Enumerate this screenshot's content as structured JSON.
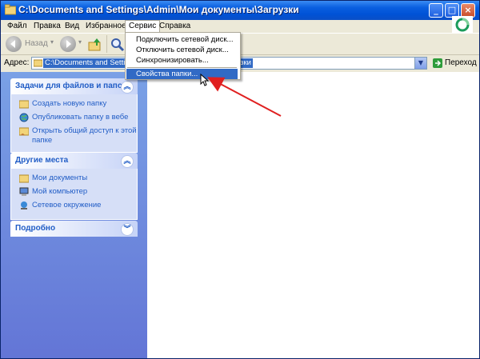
{
  "window": {
    "title": "C:\\Documents and Settings\\Admin\\Мои документы\\Загрузки"
  },
  "titlebar_buttons": {
    "minimize": "_",
    "maximize": "□",
    "close": "×"
  },
  "menubar": {
    "items": [
      "Файл",
      "Правка",
      "Вид",
      "Избранное",
      "Сервис",
      "Справка"
    ],
    "active": "Сервис"
  },
  "toolbar": {
    "back_label": "Назад"
  },
  "address": {
    "label": "Адрес:",
    "value": "C:\\Documents and Settings\\Admin\\Мои документы\\Загрузки",
    "go_label": "Переход"
  },
  "dropdown": {
    "items": [
      "Подключить сетевой диск...",
      "Отключить сетевой диск...",
      "Синхронизировать...",
      "Свойства папки..."
    ],
    "highlighted": "Свойства папки..."
  },
  "left_pane": {
    "tasks": {
      "title": "Задачи для файлов и папок",
      "items": [
        "Создать новую папку",
        "Опубликовать папку в вебе",
        "Открыть общий доступ к этой папке"
      ]
    },
    "other_places": {
      "title": "Другие места",
      "items": [
        "Мои документы",
        "Мой компьютер",
        "Сетевое окружение"
      ]
    },
    "details": {
      "title": "Подробно"
    }
  },
  "colors": {
    "titlebar": "#0052d6",
    "selection": "#316ac5",
    "task_link": "#215dc6",
    "annotation_arrow": "#e02020"
  }
}
